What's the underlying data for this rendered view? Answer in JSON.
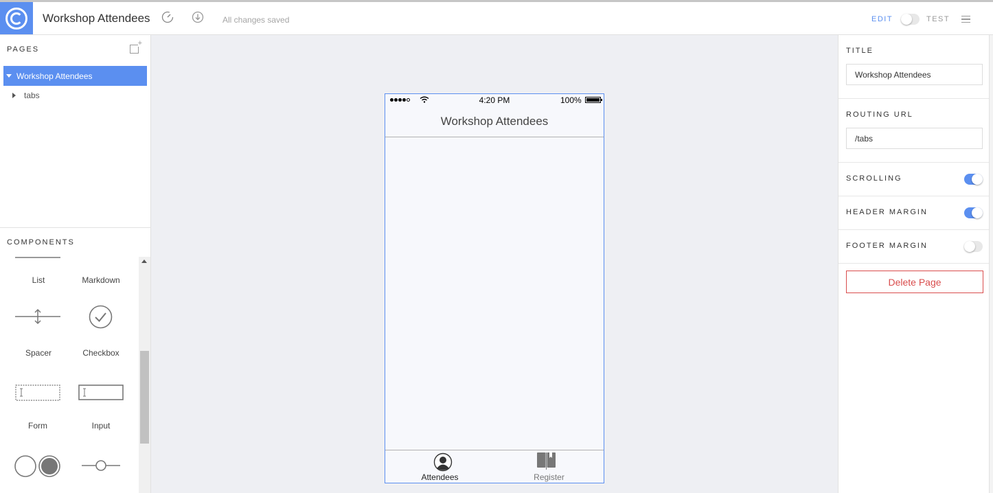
{
  "app": {
    "title": "Workshop Attendees",
    "save_status": "All changes saved",
    "mode_edit": "EDIT",
    "mode_test": "TEST",
    "mode": "edit",
    "accent_color": "#5b8ff0"
  },
  "pages_panel": {
    "title": "PAGES",
    "items": [
      {
        "label": "Workshop Attendees",
        "selected": true,
        "expanded": true
      },
      {
        "label": "tabs",
        "selected": false,
        "expanded": false
      }
    ]
  },
  "components_panel": {
    "title": "COMPONENTS",
    "items": [
      {
        "label": "List",
        "icon": "list-icon"
      },
      {
        "label": "Markdown",
        "icon": "markdown-icon"
      },
      {
        "label": "Spacer",
        "icon": "spacer-icon"
      },
      {
        "label": "Checkbox",
        "icon": "checkbox-icon"
      },
      {
        "label": "Form",
        "icon": "form-icon"
      },
      {
        "label": "Input",
        "icon": "input-icon"
      },
      {
        "label": "",
        "icon": "radio-icon"
      },
      {
        "label": "",
        "icon": "range-icon"
      }
    ]
  },
  "phone": {
    "status_time": "4:20 PM",
    "battery": "100%",
    "nav_title": "Workshop Attendees",
    "tabs": [
      {
        "label": "Attendees",
        "icon": "person-icon",
        "active": true
      },
      {
        "label": "Register",
        "icon": "book-icon",
        "active": false
      }
    ]
  },
  "properties": {
    "title_label": "TITLE",
    "title_value": "Workshop Attendees",
    "routing_label": "ROUTING URL",
    "routing_value": "/tabs",
    "scrolling_label": "SCROLLING",
    "scrolling": true,
    "header_margin_label": "HEADER MARGIN",
    "header_margin": true,
    "footer_margin_label": "FOOTER MARGIN",
    "footer_margin": false,
    "delete_label": "Delete Page",
    "danger_color": "#d94c4c"
  }
}
